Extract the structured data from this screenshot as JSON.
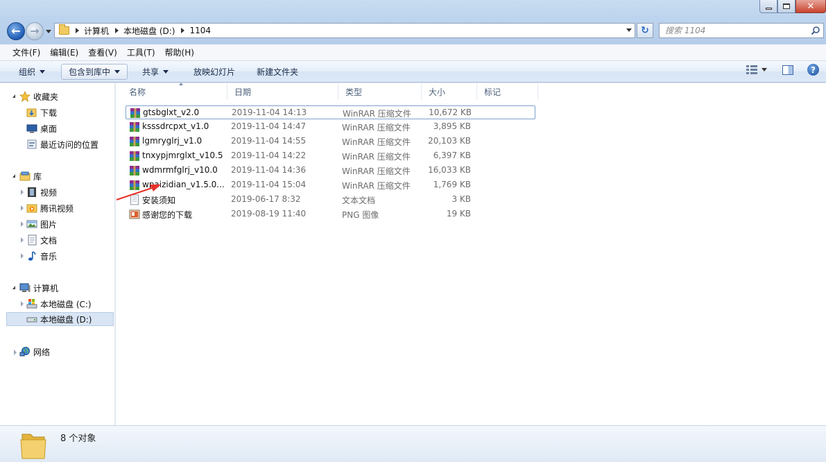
{
  "window": {
    "minimize_icon": "minimize-icon",
    "maximize_icon": "maximize-icon",
    "close_glyph": "✕"
  },
  "address": {
    "crumbs": [
      "计算机",
      "本地磁盘 (D:)",
      "1104"
    ]
  },
  "search": {
    "placeholder": "搜索 1104"
  },
  "menu": [
    "文件(F)",
    "编辑(E)",
    "查看(V)",
    "工具(T)",
    "帮助(H)"
  ],
  "toolbar": {
    "organize": "组织",
    "include_in_library": "包含到库中",
    "share": "共享",
    "slideshow": "放映幻灯片",
    "new_folder": "新建文件夹"
  },
  "nav": {
    "favorites": "收藏夹",
    "downloads": "下载",
    "desktop": "桌面",
    "recent": "最近访问的位置",
    "libraries": "库",
    "videos": "视频",
    "tencent_video": "腾讯视频",
    "pictures": "图片",
    "documents": "文档",
    "music": "音乐",
    "computer": "计算机",
    "drive_c": "本地磁盘 (C:)",
    "drive_d": "本地磁盘 (D:)",
    "network": "网络"
  },
  "columns": {
    "name": "名称",
    "date": "日期",
    "type": "类型",
    "size": "大小",
    "tags": "标记"
  },
  "files": [
    {
      "name": "gtsbglxt_v2.0",
      "date": "2019-11-04 14:13",
      "type": "WinRAR 压缩文件",
      "size": "10,672 KB",
      "icon": "winrar-icon"
    },
    {
      "name": "ksssdrcpxt_v1.0",
      "date": "2019-11-04 14:47",
      "type": "WinRAR 压缩文件",
      "size": "3,895 KB",
      "icon": "winrar-icon"
    },
    {
      "name": "lgmryglrj_v1.0",
      "date": "2019-11-04 14:55",
      "type": "WinRAR 压缩文件",
      "size": "20,103 KB",
      "icon": "winrar-icon"
    },
    {
      "name": "tnxypjmrglxt_v10.5",
      "date": "2019-11-04 14:22",
      "type": "WinRAR 压缩文件",
      "size": "6,397 KB",
      "icon": "winrar-icon"
    },
    {
      "name": "wdmrmfglrj_v10.0",
      "date": "2019-11-04 14:36",
      "type": "WinRAR 压缩文件",
      "size": "16,033 KB",
      "icon": "winrar-icon"
    },
    {
      "name": "wpaizidian_v1.5.0....",
      "date": "2019-11-04 15:04",
      "type": "WinRAR 压缩文件",
      "size": "1,769 KB",
      "icon": "winrar-icon"
    },
    {
      "name": "安装须知",
      "date": "2019-06-17 8:32",
      "type": "文本文档",
      "size": "3 KB",
      "icon": "text-file-icon"
    },
    {
      "name": "感谢您的下载",
      "date": "2019-08-19 11:40",
      "type": "PNG 图像",
      "size": "19 KB",
      "icon": "png-image-icon"
    }
  ],
  "status": {
    "count_text": "8 个对象"
  },
  "colors": {
    "accent": "#1e5cb3",
    "annotation_arrow": "#e8322b",
    "selection": "#d9e5f4"
  }
}
